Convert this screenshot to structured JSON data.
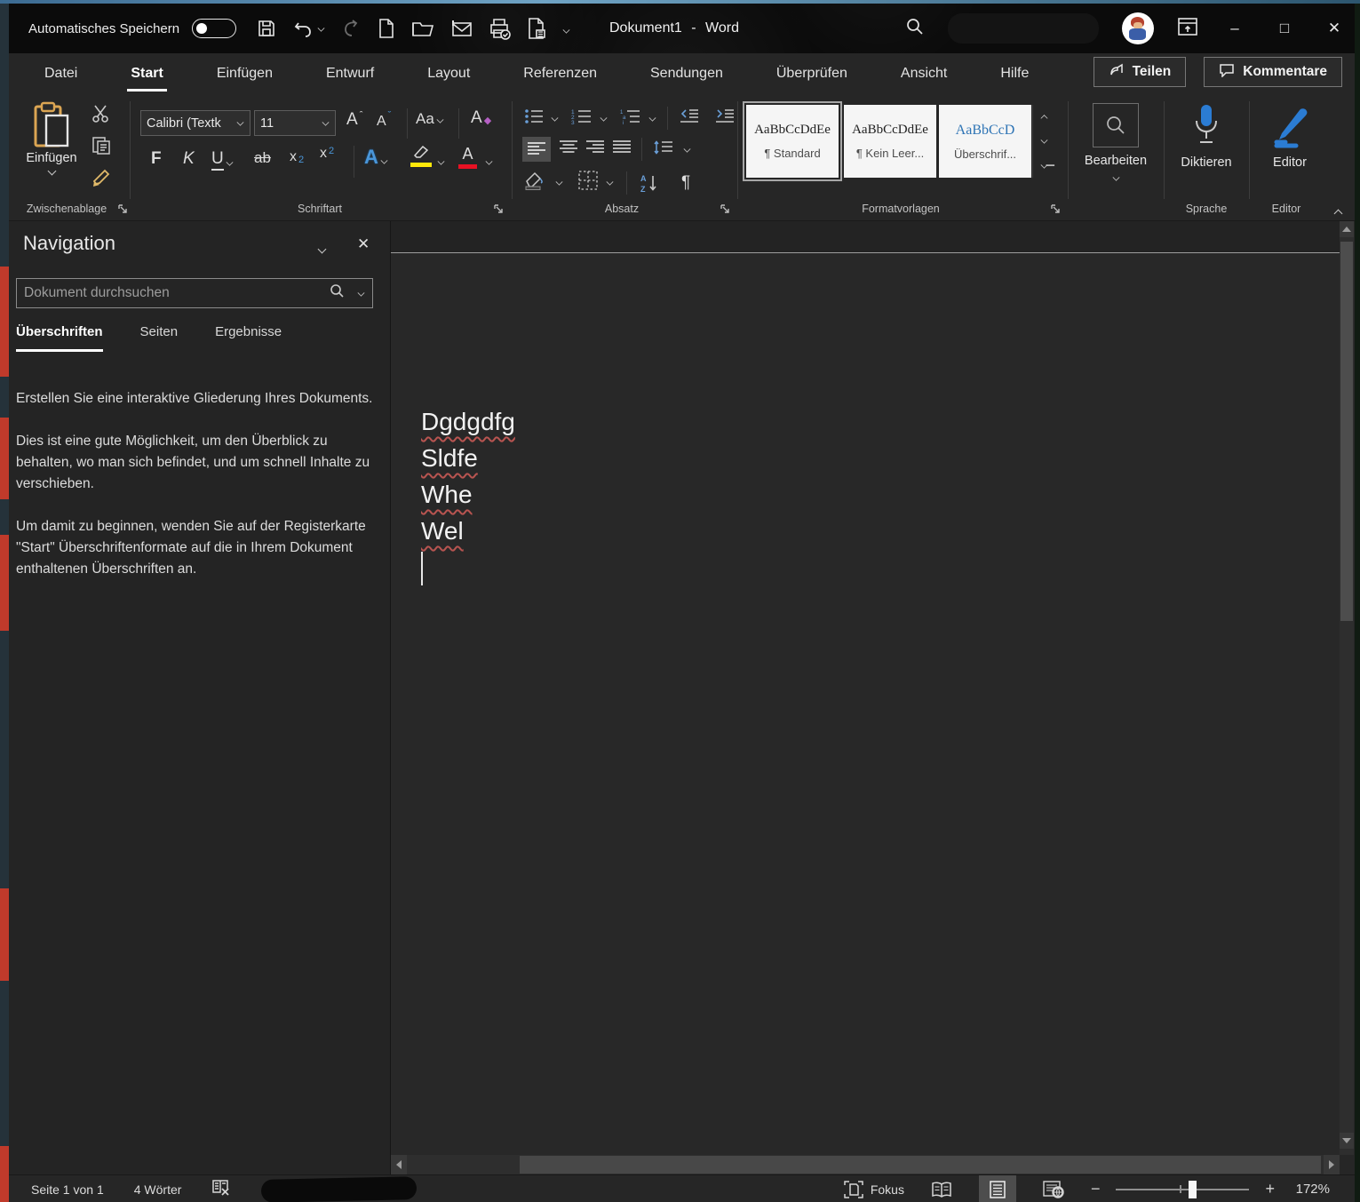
{
  "window": {
    "autosave_label": "Automatisches Speichern",
    "title": "Dokument1 - Word"
  },
  "ribbon": {
    "tabs": [
      "Datei",
      "Start",
      "Einfügen",
      "Entwurf",
      "Layout",
      "Referenzen",
      "Sendungen",
      "Überprüfen",
      "Ansicht",
      "Hilfe"
    ],
    "share_label": "Teilen",
    "comments_label": "Kommentare",
    "clipboard": {
      "paste_label": "Einfügen",
      "group_label": "Zwischenablage"
    },
    "font": {
      "name": "Calibri (Textk",
      "size": "11",
      "group_label": "Schriftart",
      "bold": "F",
      "italic": "K",
      "underline": "U",
      "strike": "ab",
      "sub_base": "x",
      "sub_script": "2",
      "sup_base": "x",
      "sup_script": "2",
      "grow": "A",
      "shrink": "A",
      "case": "Aa",
      "clear": "A",
      "effects": "A",
      "color": "A"
    },
    "paragraph": {
      "group_label": "Absatz",
      "pilcrow": "¶",
      "sort_a": "A",
      "sort_z": "Z"
    },
    "styles": {
      "group_label": "Formatvorlagen",
      "cards": [
        {
          "sample": "AaBbCcDdEe",
          "name": "¶ Standard"
        },
        {
          "sample": "AaBbCcDdEe",
          "name": "¶ Kein Leer..."
        },
        {
          "sample": "AaBbCcD",
          "name": "Überschrif..."
        }
      ]
    },
    "editing": {
      "label": "Bearbeiten"
    },
    "language": {
      "label": "Diktieren",
      "group_label": "Sprache"
    },
    "editor": {
      "label": "Editor",
      "group_label": "Editor"
    }
  },
  "navigation": {
    "title": "Navigation",
    "search_placeholder": "Dokument durchsuchen",
    "tabs": [
      "Überschriften",
      "Seiten",
      "Ergebnisse"
    ],
    "paragraphs": [
      "Erstellen Sie eine interaktive Gliederung Ihres Dokuments.",
      "Dies ist eine gute Möglichkeit, um den Überblick zu behalten, wo man sich befindet, und um schnell Inhalte zu verschieben.",
      "Um damit zu beginnen, wenden Sie auf der Registerkarte \"Start\" Überschriftenformate auf die in Ihrem Dokument enthaltenen Überschriften an."
    ]
  },
  "document": {
    "lines": [
      "Dgdgdfg",
      "Sldfe",
      "Whe",
      "Wel"
    ]
  },
  "status_bar": {
    "page": "Seite 1 von 1",
    "words": "4 Wörter",
    "focus_label": "Fokus",
    "zoom_value": "172%"
  },
  "colors": {
    "accent_blue": "#4a96d9",
    "highlight_yellow": "#ffe80a",
    "font_red": "#e81123",
    "squiggle_red": "#b85450"
  }
}
